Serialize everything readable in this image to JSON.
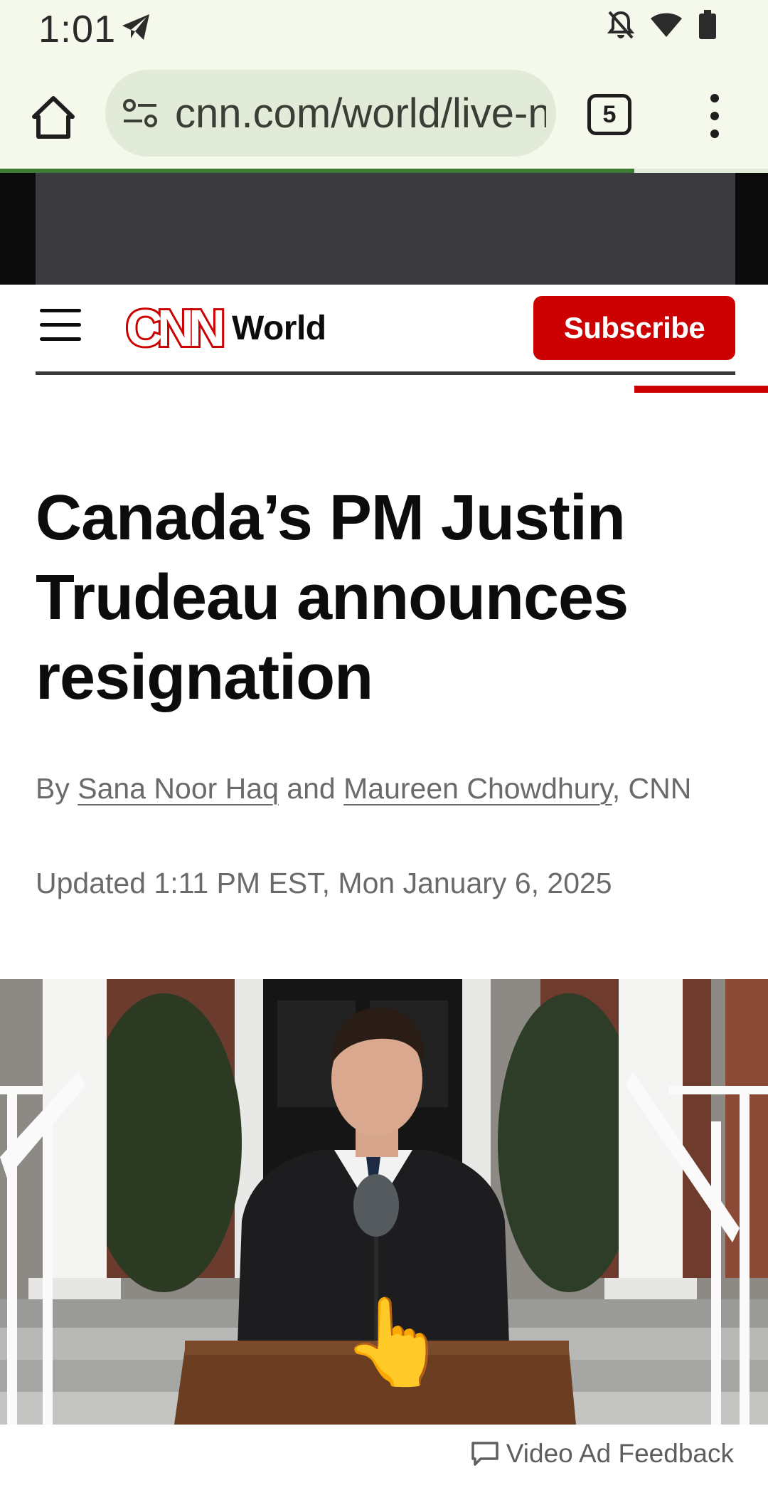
{
  "status_bar": {
    "time": "1:01",
    "icons": [
      "telegram-icon",
      "bell-off-icon",
      "wifi-icon",
      "battery-icon"
    ]
  },
  "browser": {
    "url": "cnn.com/world/live-news",
    "tab_count": "5",
    "load_progress": 0.826
  },
  "header": {
    "logo_text": "CNN",
    "section": "World",
    "subscribe_label": "Subscribe",
    "colors": {
      "brand": "#cc0000",
      "text": "#0c0c0c"
    }
  },
  "article": {
    "headline": "Canada’s PM Justin Trudeau announces resignation",
    "byline_prefix": "By",
    "author_1": "Sana Noor Haq",
    "byline_conj": "and",
    "author_2": "Maureen Chowdhury",
    "byline_suffix": ", CNN",
    "updated": "Updated 1:11 PM EST, Mon January 6, 2025"
  },
  "video": {
    "ad_feedback_label": "Video Ad Feedback",
    "overlay_emoji": "👆"
  }
}
